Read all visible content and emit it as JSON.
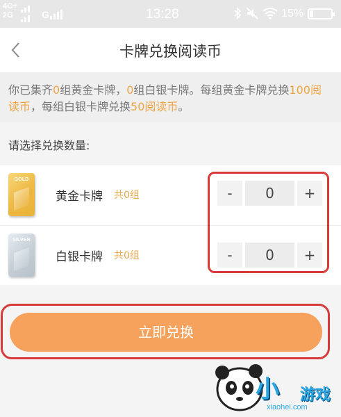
{
  "status_bar": {
    "network1": "4G+",
    "network2": "2G",
    "network3": "G",
    "time": "13:28",
    "battery": "15%",
    "icons": [
      "bluetooth-icon",
      "mute-icon",
      "wifi-icon",
      "battery-icon"
    ]
  },
  "header": {
    "back_icon": "chevron-left-icon",
    "title": "卡牌兑换阅读币"
  },
  "notice": {
    "p1": "你已集齐",
    "gold_sets": "0",
    "p2": "组黄金卡牌，",
    "silver_sets": "0",
    "p3": "组白银卡牌。每组黄金卡牌兑换",
    "gold_rate": "100阅读币",
    "p4": "，每组白银卡牌兑换",
    "silver_rate": "50阅读币",
    "p5": "。"
  },
  "prompt": "请选择兑换数量:",
  "cards": [
    {
      "tag": "GOLD",
      "name": "黄金卡牌",
      "count": "共0组",
      "minus": "-",
      "quantity": "0",
      "plus": "+"
    },
    {
      "tag": "SILVER",
      "name": "白银卡牌",
      "count": "共0组",
      "minus": "-",
      "quantity": "0",
      "plus": "+"
    }
  ],
  "redeem_button": "立即兑换",
  "watermark": {
    "text1": "小",
    "text2": "游戏",
    "url": "xiaohei.com"
  },
  "colors": {
    "accent": "#f0a443",
    "button": "#f6a15c",
    "highlight_box": "#d83a3a"
  }
}
